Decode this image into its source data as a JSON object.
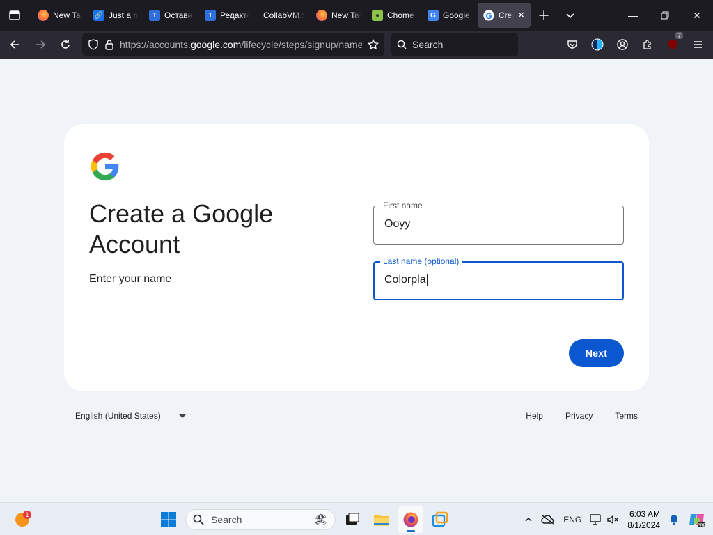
{
  "browser": {
    "tabs": [
      {
        "label": "New Tab",
        "icon": "firefox-icon",
        "color": "#ff7139"
      },
      {
        "label": "Just a moment...",
        "icon": "link-icon",
        "color": "#1a73e8"
      },
      {
        "label": "Оставить",
        "icon": "telegraph-icon",
        "color": "#2f6fdb"
      },
      {
        "label": "Редактор",
        "icon": "telegraph-icon",
        "color": "#2f6fdb"
      },
      {
        "label": "CollabVM.S",
        "icon": "",
        "color": ""
      },
      {
        "label": "New Tab",
        "icon": "firefox-icon",
        "color": "#ff7139"
      },
      {
        "label": "Chome",
        "icon": "chome-icon",
        "color": "#8bc34a"
      },
      {
        "label": "Google",
        "icon": "google-translate-icon",
        "color": "#4285f4"
      },
      {
        "label": "Create",
        "icon": "google-icon",
        "color": "#ffffff",
        "active": true
      }
    ],
    "url_prefix": "https://accounts.",
    "url_domain": "google.com",
    "url_path": "/lifecycle/steps/signup/name",
    "search_placeholder": "Search",
    "extension_badge": "7"
  },
  "page": {
    "heading": "Create a Google Account",
    "subheading": "Enter your name",
    "first_name_label": "First name",
    "first_name_value": "Ooyy",
    "last_name_label": "Last name (optional)",
    "last_name_value": "Colorpla",
    "next_label": "Next",
    "language": "English (United States)",
    "footer_links": [
      "Help",
      "Privacy",
      "Terms"
    ],
    "accent_color": "#0b57d0"
  },
  "taskbar": {
    "weather_badge": "1",
    "search_placeholder": "Search",
    "lang": "ENG",
    "time": "6:03 AM",
    "date": "8/1/2024"
  }
}
